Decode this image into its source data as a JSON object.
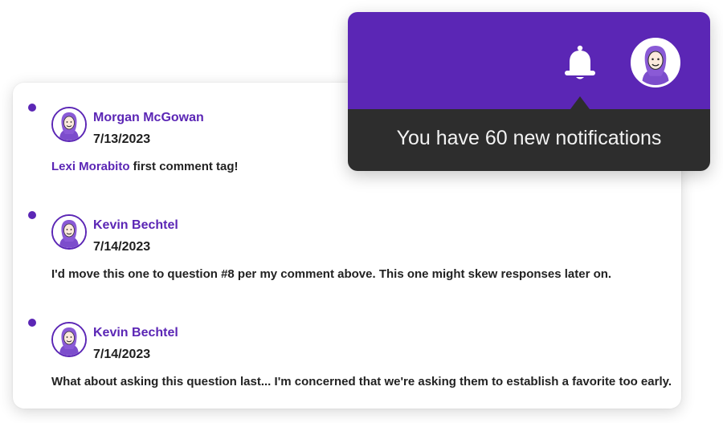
{
  "colors": {
    "brand_purple": "#5b26b5",
    "tooltip_dark": "#2d2d2d",
    "text_dark": "#222222"
  },
  "notifications": {
    "message": "You have 60 new notifications",
    "bell_icon": "bell-icon",
    "avatar": "user-avatar"
  },
  "comments": [
    {
      "author": "Morgan McGowan",
      "date": "7/13/2023",
      "mention": "Lexi Morabito",
      "text": " first comment tag!",
      "unread": true
    },
    {
      "author": "Kevin Bechtel",
      "date": "7/14/2023",
      "mention": "",
      "text": "I'd move this one to question #8 per my comment above. This one might skew responses later on.",
      "unread": true
    },
    {
      "author": "Kevin Bechtel",
      "date": "7/14/2023",
      "mention": "",
      "text": "What about asking this question last... I'm concerned that we're asking them to establish a favorite too early.",
      "unread": true
    }
  ]
}
